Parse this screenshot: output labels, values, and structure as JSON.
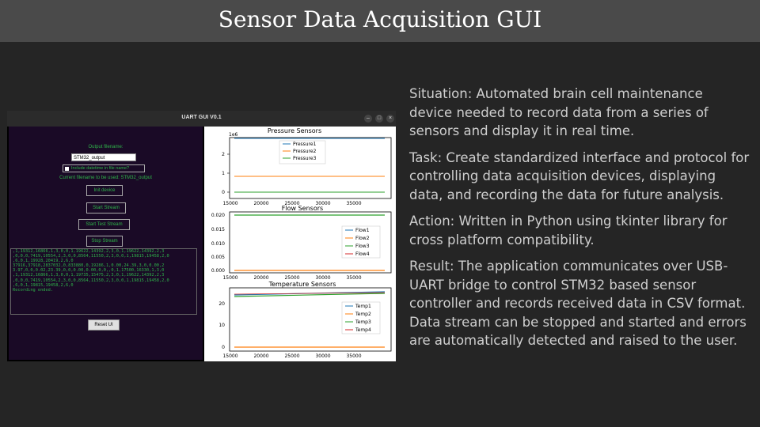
{
  "slide": {
    "title": "Sensor Data Acquisition GUI"
  },
  "window": {
    "title": "UART GUI V0.1",
    "btn_min": "–",
    "btn_max": "□",
    "btn_close": "×"
  },
  "form": {
    "output_filename_label": "Output filename:",
    "output_filename_value": "STM32_output",
    "include_datetime_label": "Include datetime in file name?",
    "current_filename": "Current filename to be used: STM32_output",
    "init_device": "Init device",
    "start_stream": "Start Stream",
    "start_test_stream": "Start Test Stream",
    "stop_stream": "Stop Stream",
    "reset_ui": "Reset UI"
  },
  "console_lines": [
    ",1,19312,16866,1,3,0,0,1,19622,14392,2,3,0,1,19622,14392,2,3",
    ",0,0,0,7419,10554,2,3,0,0,8564,11550,2,3,0,0,1,19815,19458,2,0",
    ",6,0,1,19928,20419,2,6,0",
    "37916,37918,2837032,0,833880,0,19286,1,0.00,24.39,3,0,0.00,2",
    "3.97,0,0,0.02,23.39,0,0,0.00,0.00,0,0,,0,1,17500,16330,1,3,0",
    ",1,19312,16866,1,3,0,0,1,19735,15475,2,3,0,1,19622,14392,2,3",
    ",0,0,0,7419,10554,2,3,0,0,8564,11550,2,3,0,0,1,19815,19458,2,0",
    ",6,0,1,19815,19458,2,6,0",
    "Recording ended."
  ],
  "colors": {
    "blue": "#1f77b4",
    "orange": "#ff7f0e",
    "green": "#2ca02c",
    "red": "#d62728"
  },
  "charts": {
    "pressure": {
      "title": "Pressure Sensors",
      "multiplier": "1e6",
      "yticks": [
        "2",
        "1",
        "0"
      ],
      "legend": [
        "Pressure1",
        "Pressure2",
        "Pressure3"
      ]
    },
    "flow": {
      "title": "Flow Sensors",
      "yticks": [
        "0.020",
        "0.015",
        "0.010",
        "0.005",
        "0.000"
      ],
      "legend": [
        "Flow1",
        "Flow2",
        "Flow3",
        "Flow4"
      ]
    },
    "temp": {
      "title": "Temperature Sensors",
      "yticks": [
        "20",
        "10",
        "0"
      ],
      "legend": [
        "Temp1",
        "Temp2",
        "Temp3",
        "Temp4"
      ]
    },
    "xticks": [
      "15000",
      "20000",
      "25000",
      "30000",
      "35000"
    ]
  },
  "bullets": {
    "situation": "Situation: Automated brain cell maintenance device needed to record data from a series of sensors and display it in real time.",
    "task": "Task: Create standardized interface and protocol for controlling data acquisition devices, displaying data, and recording the data for future analysis.",
    "action": "Action: Written in Python using tkinter library for cross platform compatibility.",
    "result": "Result: The application communicates over USB-UART bridge to control STM32 based sensor controller and records received data in CSV format. Data stream can be stopped and started and errors are automatically detected and raised to the user."
  }
}
